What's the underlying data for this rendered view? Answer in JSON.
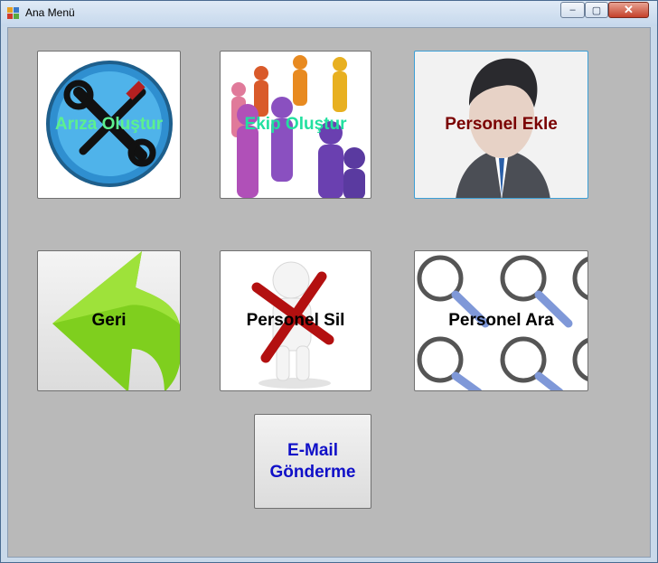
{
  "window": {
    "title": "Ana Menü",
    "minimize": "–",
    "maximize": "▢",
    "close": "✕"
  },
  "buttons": {
    "ariza": {
      "label": "Arıza Oluştur",
      "color": "#5cf08f"
    },
    "ekip": {
      "label": "Ekip Oluştur",
      "color": "#22e0a0"
    },
    "personel_ekle": {
      "label": "Personel Ekle",
      "color": "#7a0000"
    },
    "geri": {
      "label": "Geri",
      "color": "#000000"
    },
    "personel_sil": {
      "label": "Personel Sil",
      "color": "#000000"
    },
    "personel_ara": {
      "label": "Personel Ara",
      "color": "#000000"
    },
    "email": {
      "label_line1": "E-Mail",
      "label_line2": "Gönderme",
      "color": "#1010c8"
    }
  }
}
